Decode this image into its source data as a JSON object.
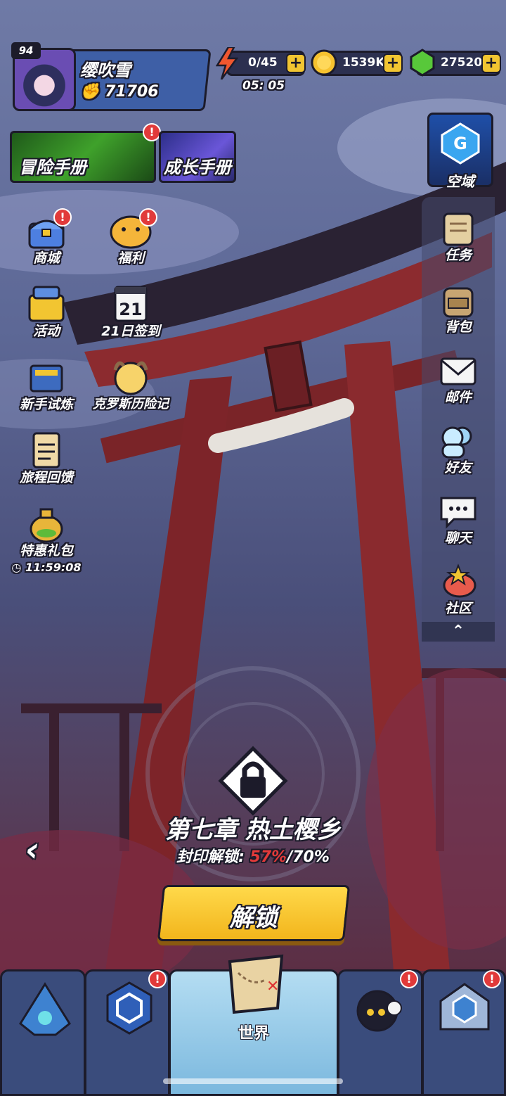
{
  "profile": {
    "level": "94",
    "name": "缨吹雪",
    "power": "71706"
  },
  "resources": {
    "energy": "0/45",
    "energy_timer": "05: 05",
    "gold": "1539K",
    "gems": "27520"
  },
  "handbooks": {
    "adventure": "冒险手册",
    "growth": "成长手册"
  },
  "space_domain": "空域",
  "left_menu": {
    "shop": "商城",
    "welfare": "福利",
    "activity": "活动",
    "signin": "21日签到",
    "signin_day": "21",
    "newbie": "新手试炼",
    "chronicle": "克罗斯历险记",
    "journey": "旅程回馈",
    "gift": "特惠礼包",
    "gift_timer": "11:59:08"
  },
  "right_menu": {
    "quest": "任务",
    "bag": "背包",
    "mail": "邮件",
    "friends": "好友",
    "chat": "聊天",
    "community": "社区"
  },
  "chapter": {
    "title": "第七章 热土樱乡",
    "seal_label": "封印解锁: ",
    "seal_current": "57%",
    "seal_target": "/70%",
    "unlock_button": "解锁"
  },
  "nav": {
    "world": "世界"
  },
  "badge_mark": "!",
  "colors": {
    "accent_gold": "#f2c531",
    "badge_red": "#e13a3a",
    "panel_blue": "#3e5fa6"
  }
}
